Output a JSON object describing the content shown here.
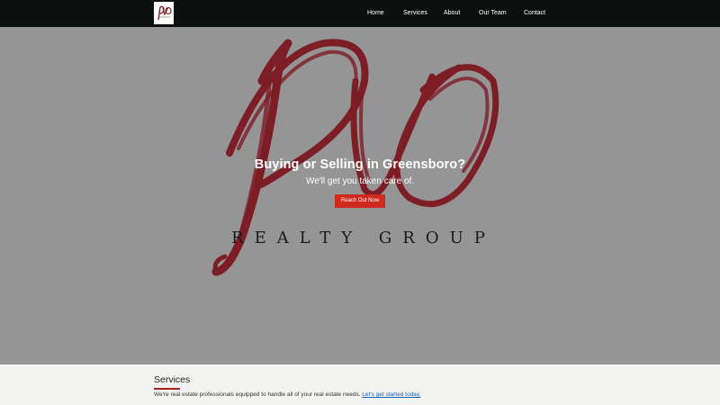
{
  "navbar": {
    "logo_icon": "pvo-logo-icon",
    "links": [
      {
        "label": "Home"
      },
      {
        "label": "Services"
      },
      {
        "label": "About"
      },
      {
        "label": "Our Team"
      },
      {
        "label": "Contact"
      }
    ]
  },
  "hero": {
    "title": "Buying or Selling in Greensboro?",
    "subtitle": "We'll get you taken care of.",
    "cta_label": "Reach Out Now",
    "brand_text": "REALTY GROUP"
  },
  "services": {
    "heading": "Services",
    "text": "We're real estate professionals equipped to handle all of your real estate needs. ",
    "link_label": "Let's get started today."
  },
  "colors": {
    "nav_bg": "#0c100e",
    "hero_bg": "#959595",
    "logo_red": "#7d1d25",
    "cta_red": "#d02a1e",
    "link_blue": "#1a5fb0"
  }
}
